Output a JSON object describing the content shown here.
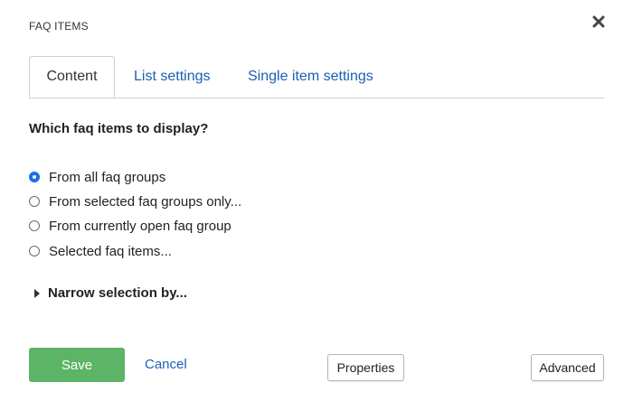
{
  "dialog": {
    "title": "FAQ ITEMS",
    "close_icon": "close-icon"
  },
  "tabs": [
    {
      "label": "Content",
      "active": true
    },
    {
      "label": "List settings",
      "active": false
    },
    {
      "label": "Single item settings",
      "active": false
    }
  ],
  "content": {
    "question": "Which faq items to display?",
    "options": [
      {
        "label": "From all faq groups",
        "checked": true
      },
      {
        "label": "From selected faq groups only...",
        "checked": false
      },
      {
        "label": "From currently open faq group",
        "checked": false
      },
      {
        "label": "Selected faq items...",
        "checked": false
      }
    ],
    "narrow_label": "Narrow selection by..."
  },
  "footer": {
    "save_label": "Save",
    "cancel_label": "Cancel",
    "properties_label": "Properties",
    "advanced_label": "Advanced"
  },
  "colors": {
    "link": "#1a5fb4",
    "save_button": "#5cb466",
    "radio_checked": "#1f6fe5"
  }
}
